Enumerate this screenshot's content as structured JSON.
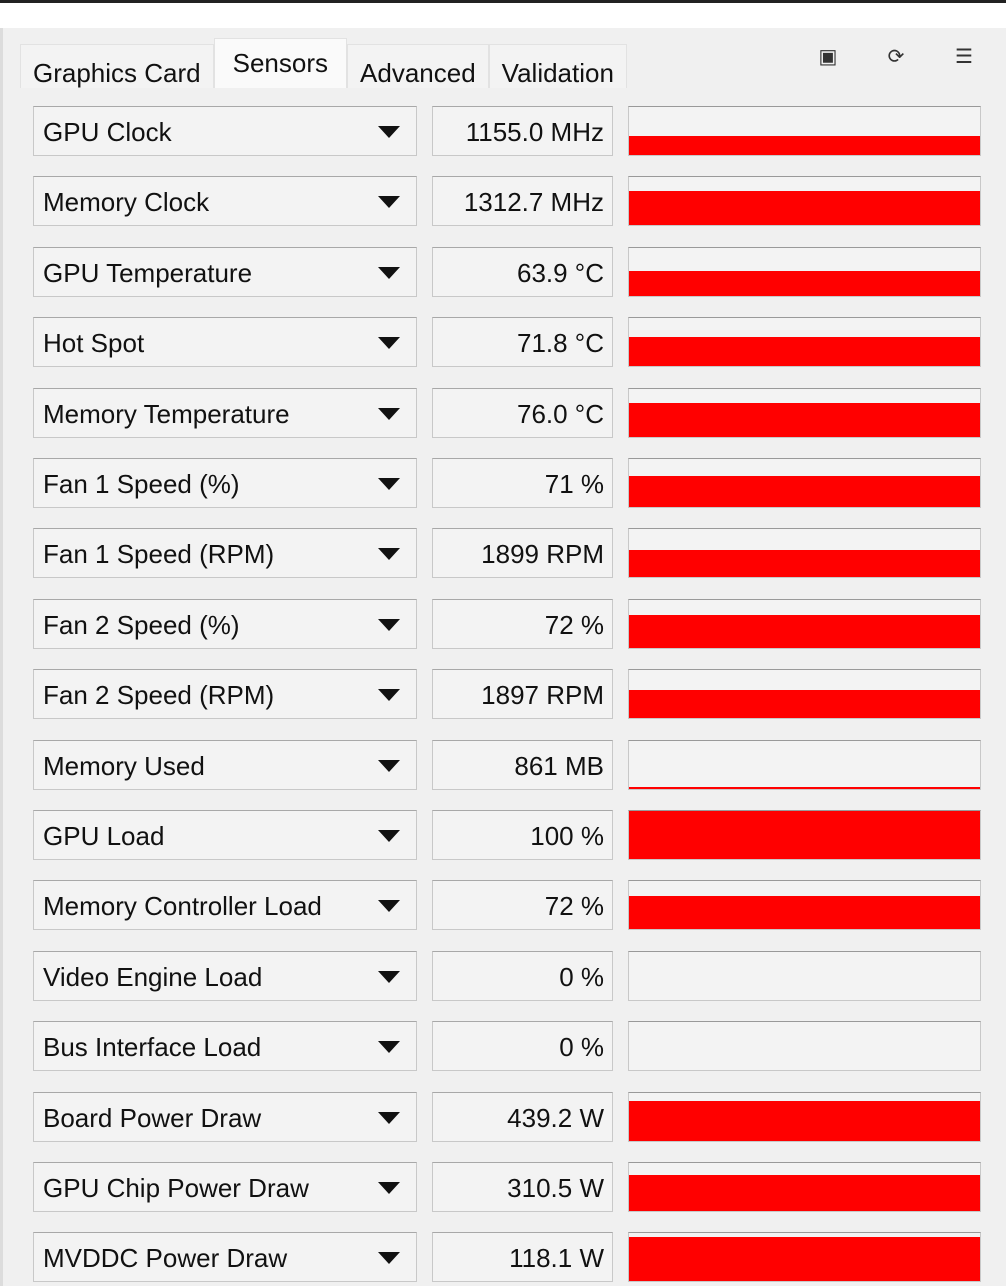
{
  "tabs": [
    {
      "label": "Graphics Card",
      "active": false
    },
    {
      "label": "Sensors",
      "active": true
    },
    {
      "label": "Advanced",
      "active": false
    },
    {
      "label": "Validation",
      "active": false
    }
  ],
  "toolbar_icons": [
    "camera-icon",
    "refresh-icon",
    "menu-icon"
  ],
  "graph_color": "#ff0000",
  "sensors": [
    {
      "name": "GPU Clock",
      "value": "1155.0 MHz",
      "graph_level": 0.4
    },
    {
      "name": "Memory Clock",
      "value": "1312.7 MHz",
      "graph_level": 0.72
    },
    {
      "name": "GPU Temperature",
      "value": "63.9 °C",
      "graph_level": 0.52
    },
    {
      "name": "Hot Spot",
      "value": "71.8 °C",
      "graph_level": 0.6
    },
    {
      "name": "Memory Temperature",
      "value": "76.0 °C",
      "graph_level": 0.7
    },
    {
      "name": "Fan 1 Speed (%)",
      "value": "71 %",
      "graph_level": 0.64
    },
    {
      "name": "Fan 1 Speed (RPM)",
      "value": "1899 RPM",
      "graph_level": 0.58
    },
    {
      "name": "Fan 2 Speed (%)",
      "value": "72 %",
      "graph_level": 0.68
    },
    {
      "name": "Fan 2 Speed (RPM)",
      "value": "1897 RPM",
      "graph_level": 0.58
    },
    {
      "name": "Memory Used",
      "value": "861 MB",
      "graph_level": 0.03
    },
    {
      "name": "GPU Load",
      "value": "100 %",
      "graph_level": 1.0
    },
    {
      "name": "Memory Controller Load",
      "value": "72 %",
      "graph_level": 0.7
    },
    {
      "name": "Video Engine Load",
      "value": "0 %",
      "graph_level": 0
    },
    {
      "name": "Bus Interface Load",
      "value": "0 %",
      "graph_level": 0
    },
    {
      "name": "Board Power Draw",
      "value": "439.2 W",
      "graph_level": 0.82
    },
    {
      "name": "GPU Chip Power Draw",
      "value": "310.5 W",
      "graph_level": 0.74
    },
    {
      "name": "MVDDC Power Draw",
      "value": "118.1 W",
      "graph_level": 0.92
    }
  ]
}
